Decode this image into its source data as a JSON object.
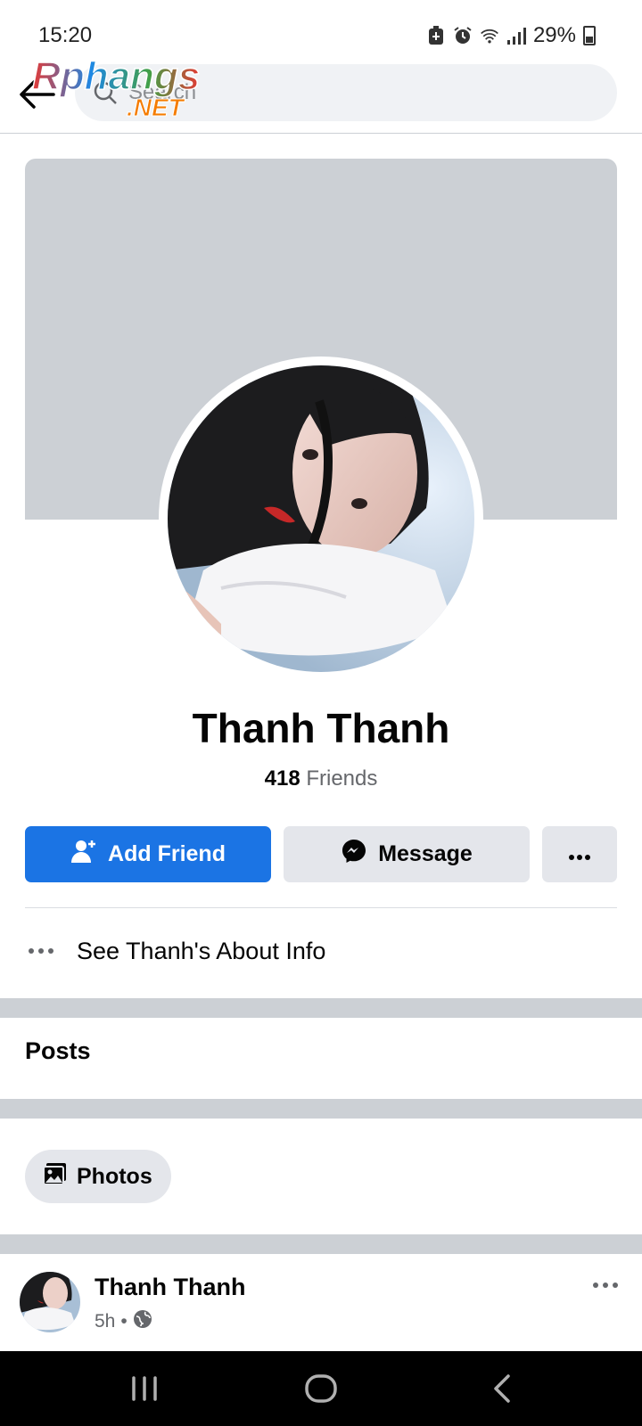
{
  "status_bar": {
    "time": "15:20",
    "battery": "29%",
    "icons": [
      "battery-saver-icon",
      "alarm-icon",
      "wifi-icon",
      "signal-icon",
      "battery-icon"
    ]
  },
  "header": {
    "back_icon": "arrow-left-icon",
    "search_placeholder": "Search",
    "watermark_line1": "Rphangs",
    "watermark_line2": ".NET"
  },
  "profile": {
    "name": "Thanh Thanh",
    "friends_count": "418",
    "friends_label": "Friends",
    "buttons": {
      "add_friend": "Add Friend",
      "message": "Message"
    },
    "about_link": "See Thanh's About Info"
  },
  "sections": {
    "posts_title": "Posts",
    "photos_label": "Photos"
  },
  "post": {
    "author": "Thanh Thanh",
    "time": "5h",
    "separator": "•",
    "privacy_icon": "globe-icon"
  },
  "colors": {
    "primary": "#1b74e4",
    "cover": "#ccd0d5",
    "button_gray": "#e4e6eb",
    "text_secondary": "#65676b"
  }
}
